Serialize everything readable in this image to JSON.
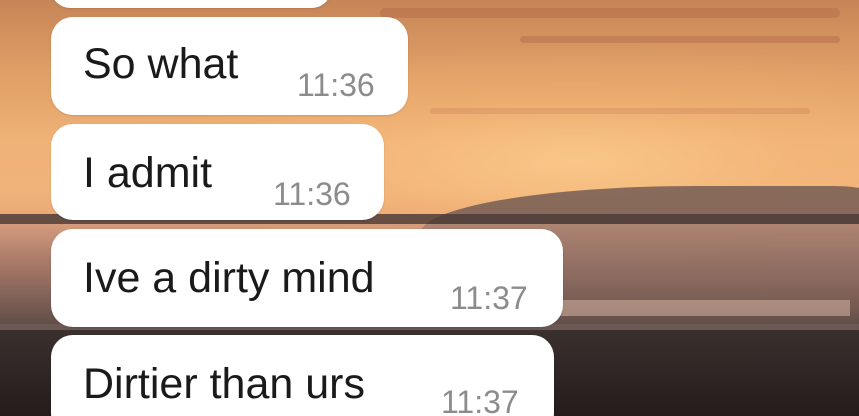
{
  "chat": {
    "messages": [
      {
        "text": "",
        "time": ""
      },
      {
        "text": "So what",
        "time": "11:36"
      },
      {
        "text": "I admit",
        "time": "11:36"
      },
      {
        "text": "Ive a dirty mind",
        "time": "11:37"
      },
      {
        "text": "Dirtier than urs",
        "time": "11:37"
      }
    ]
  },
  "colors": {
    "bubble_background": "#ffffff",
    "message_text": "#1a1a1a",
    "timestamp_text": "#8c8c8c",
    "wallpaper_sky": "#efb277",
    "wallpaper_ground": "#2c2524"
  }
}
